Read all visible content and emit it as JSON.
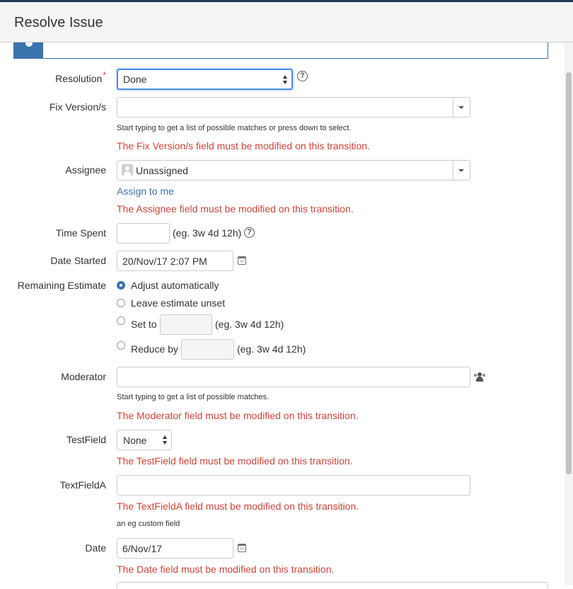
{
  "dialog": {
    "title": "Resolve Issue"
  },
  "resolution": {
    "label": "Resolution",
    "required_mark": "*",
    "value": "Done"
  },
  "fix_version": {
    "label": "Fix Version/s",
    "description": "Start typing to get a list of possible matches or press down to select.",
    "error": "The Fix Version/s field must be modified on this transition."
  },
  "assignee": {
    "label": "Assignee",
    "value": "Unassigned",
    "assign_to_me": "Assign to me",
    "error": "The Assignee field must be modified on this transition."
  },
  "time_spent": {
    "label": "Time Spent",
    "hint": "(eg. 3w 4d 12h)"
  },
  "date_started": {
    "label": "Date Started",
    "value": "20/Nov/17 2:07 PM"
  },
  "remaining_estimate": {
    "label": "Remaining Estimate",
    "options": {
      "adjust": "Adjust automatically",
      "unset": "Leave estimate unset",
      "set_to": "Set to",
      "reduce_by": "Reduce by"
    },
    "hint": "(eg. 3w 4d 12h)",
    "selected": "adjust"
  },
  "moderator": {
    "label": "Moderator",
    "description": "Start typing to get a list of possible matches.",
    "error": "The Moderator field must be modified on this transition."
  },
  "testfield": {
    "label": "TestField",
    "value": "None",
    "error": "The TestField field must be modified on this transition."
  },
  "textfielda": {
    "label": "TextFieldA",
    "error": "The TextFieldA field must be modified on this transition.",
    "description": "an eg custom field"
  },
  "date": {
    "label": "Date",
    "value": "6/Nov/17",
    "error": "The Date field must be modified on this transition."
  },
  "colors": {
    "error": "#d04437",
    "link": "#3b73af",
    "focus": "#4a90e2"
  },
  "icons": [
    "help-icon",
    "dropdown-arrow-icon",
    "avatar-icon",
    "calendar-icon",
    "user-picker-icon"
  ]
}
